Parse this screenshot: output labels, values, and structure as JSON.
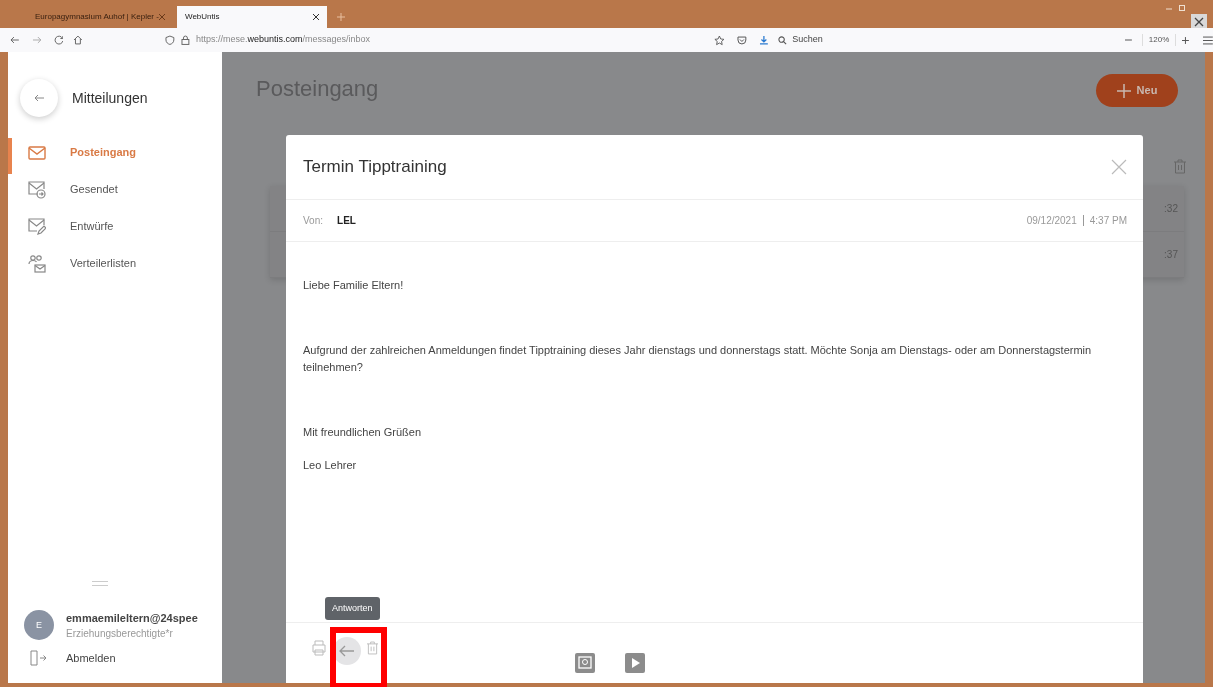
{
  "browser": {
    "tabs": [
      {
        "label": "Europagymnasium Auhof | Kepler -",
        "selected": false
      },
      {
        "label": "WebUntis",
        "selected": true
      }
    ],
    "url": "https://mese.**webuntis.com**/messages/inbox",
    "search": {
      "placeholder": "Suchen"
    },
    "zoom": "120%"
  },
  "sidebar": {
    "title": "Mitteilungen",
    "items": [
      {
        "label": "Posteingang",
        "kind": "inbox",
        "selected": true
      },
      {
        "label": "Gesendet",
        "kind": "sent",
        "selected": false
      },
      {
        "label": "Entwürfe",
        "kind": "draft",
        "selected": false
      },
      {
        "label": "Verteilerlisten",
        "kind": "lists",
        "selected": false
      }
    ],
    "user": {
      "initial": "E",
      "name": "emmaemileltern@24spee",
      "role": "Erziehungsberechtigte*r"
    },
    "logout": "Abmelden"
  },
  "page": {
    "title": "Posteingang",
    "new_button": "Neu",
    "rows": [
      {
        "time": ":32"
      },
      {
        "time": ":37"
      }
    ]
  },
  "message": {
    "title": "Termin Tipptraining",
    "from_label": "Von:",
    "from": "LEL",
    "date": "09/12/2021",
    "time": "4:37 PM",
    "paragraphs": [
      "Liebe Familie Eltern!",
      "Aufgrund der zahlreichen Anmeldungen findet Tipptraining dieses Jahr dienstags und donnerstags statt. Möchte Sonja am Dienstags- oder am Donnerstagstermin teilnehmen?",
      "Mit freundlichen Grüßen",
      "Leo Lehrer"
    ],
    "tooltip": "Antworten"
  }
}
